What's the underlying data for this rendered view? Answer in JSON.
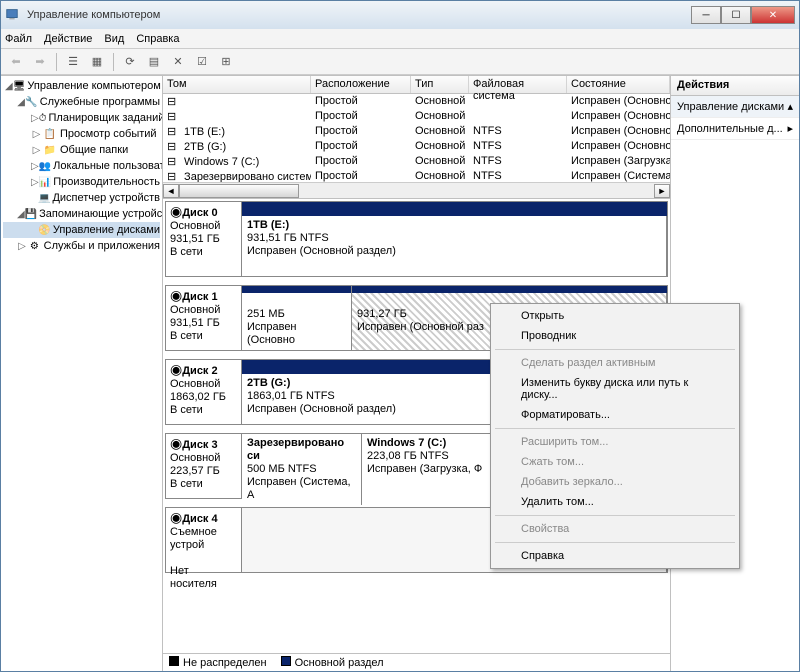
{
  "window": {
    "title": "Управление компьютером"
  },
  "menu": {
    "file": "Файл",
    "action": "Действие",
    "view": "Вид",
    "help": "Справка"
  },
  "tree": {
    "root": "Управление компьютером (л",
    "svc_programs": "Служебные программы",
    "scheduler": "Планировщик заданий",
    "eventviewer": "Просмотр событий",
    "shared": "Общие папки",
    "localusers": "Локальные пользовате",
    "perf": "Производительность",
    "devmgr": "Диспетчер устройств",
    "storage": "Запоминающие устройст",
    "diskmgmt": "Управление дисками",
    "services": "Службы и приложения"
  },
  "vol_headers": {
    "name": "Том",
    "layout": "Расположение",
    "type": "Тип",
    "fs": "Файловая система",
    "status": "Состояние"
  },
  "volumes": [
    {
      "name": "",
      "layout": "Простой",
      "type": "Основной",
      "fs": "",
      "status": "Исправен (Основно"
    },
    {
      "name": "",
      "layout": "Простой",
      "type": "Основной",
      "fs": "",
      "status": "Исправен (Основно"
    },
    {
      "name": "1TB (E:)",
      "layout": "Простой",
      "type": "Основной",
      "fs": "NTFS",
      "status": "Исправен (Основно"
    },
    {
      "name": "2TB (G:)",
      "layout": "Простой",
      "type": "Основной",
      "fs": "NTFS",
      "status": "Исправен (Основно"
    },
    {
      "name": "Windows 7 (C:)",
      "layout": "Простой",
      "type": "Основной",
      "fs": "NTFS",
      "status": "Исправен (Загрузка"
    },
    {
      "name": "Зарезервировано системой",
      "layout": "Простой",
      "type": "Основной",
      "fs": "NTFS",
      "status": "Исправен (Система,"
    }
  ],
  "disks": {
    "d0": {
      "title": "Диск 0",
      "type": "Основной",
      "size": "931,51 ГБ",
      "state": "В сети",
      "p1_name": "1TB  (E:)",
      "p1_size": "931,51 ГБ NTFS",
      "p1_status": "Исправен (Основной раздел)"
    },
    "d1": {
      "title": "Диск 1",
      "type": "Основной",
      "size": "931,51 ГБ",
      "state": "В сети",
      "p1_size": "251 МБ",
      "p1_status": "Исправен (Основно",
      "p2_size": "931,27 ГБ",
      "p2_status": "Исправен (Основной раз"
    },
    "d2": {
      "title": "Диск 2",
      "type": "Основной",
      "size": "1863,02 ГБ",
      "state": "В сети",
      "p1_name": "2TB  (G:)",
      "p1_size": "1863,01 ГБ NTFS",
      "p1_status": "Исправен (Основной раздел)"
    },
    "d3": {
      "title": "Диск 3",
      "type": "Основной",
      "size": "223,57 ГБ",
      "state": "В сети",
      "p1_name": "Зарезервировано си",
      "p1_size": "500 МБ NTFS",
      "p1_status": "Исправен (Система, А",
      "p2_name": "Windows 7  (C:)",
      "p2_size": "223,08 ГБ NTFS",
      "p2_status": "Исправен (Загрузка, Ф"
    },
    "d4": {
      "title": "Диск 4",
      "type": "Съемное устрой",
      "state": "Нет носителя"
    }
  },
  "legend": {
    "unalloc": "Не распределен",
    "primary": "Основной раздел"
  },
  "actions": {
    "header": "Действия",
    "diskmgmt": "Управление дисками",
    "more": "Дополнительные д..."
  },
  "ctx": {
    "open": "Открыть",
    "explorer": "Проводник",
    "active": "Сделать раздел активным",
    "letter": "Изменить букву диска или путь к диску...",
    "format": "Форматировать...",
    "extend": "Расширить том...",
    "shrink": "Сжать том...",
    "mirror": "Добавить зеркало...",
    "delete": "Удалить том...",
    "props": "Свойства",
    "help": "Справка"
  }
}
